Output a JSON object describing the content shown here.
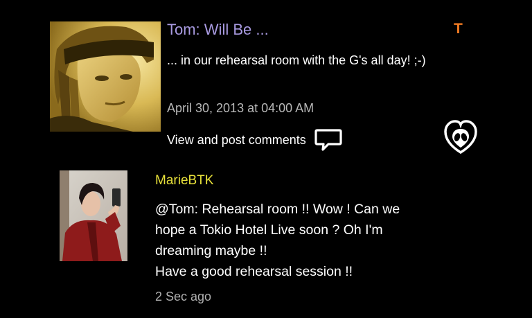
{
  "post": {
    "title": "Tom: Will Be ...",
    "badge": "T",
    "body": "... in our rehearsal room with the G's all day! ;-)",
    "date": "April 30, 2013 at 04:00 AM",
    "comments_link": "View and post comments",
    "avatar_icon": "photo-avatar",
    "comment_icon": "speech-bubble-icon",
    "fan_icon": "alien-heart-icon"
  },
  "comment": {
    "author": "MarieBTK",
    "lines": [
      "@Tom: Rehearsal room !! Wow ! Can we",
      "hope a Tokio Hotel Live soon ? Oh I'm",
      "dreaming maybe !!",
      "Have a good rehearsal session !!"
    ],
    "time": "2 Sec ago"
  },
  "colors": {
    "background": "#000000",
    "title": "#a89ae0",
    "badge": "#f07a22",
    "author": "#e8e13a",
    "meta": "#b8b8b8"
  }
}
